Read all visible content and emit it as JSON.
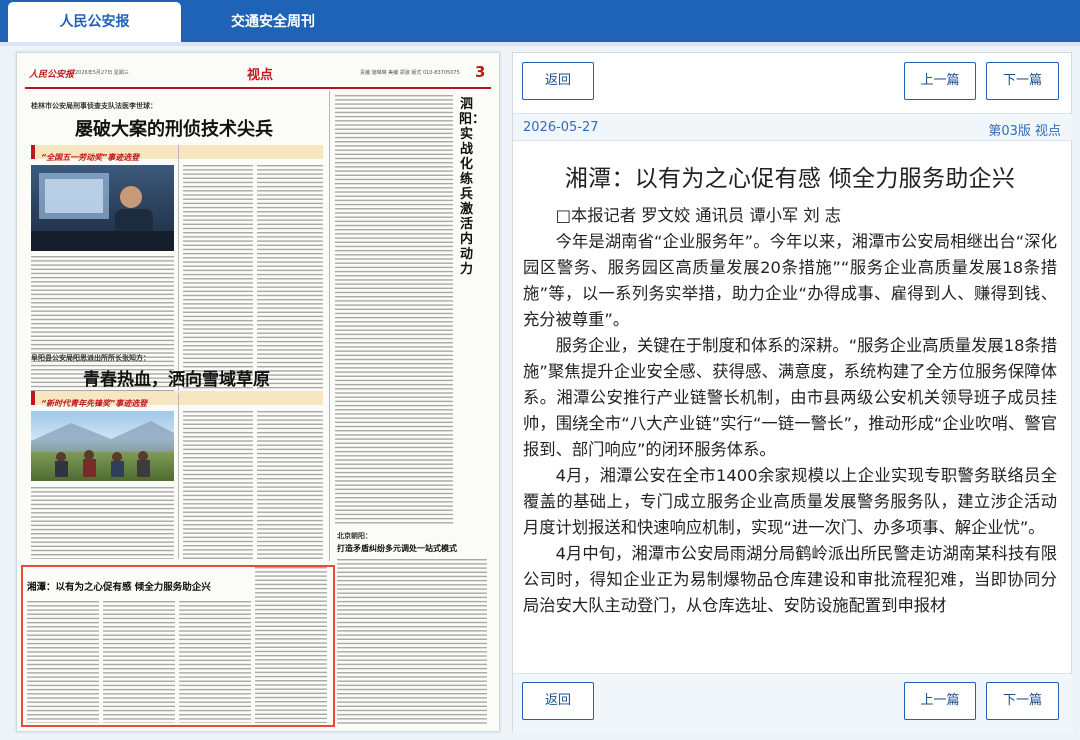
{
  "tabs": [
    {
      "label": "人民公安报",
      "active": true
    },
    {
      "label": "交通安全周刊",
      "active": false
    }
  ],
  "paper": {
    "masthead": "人民公安报",
    "date_line": "2026年5月27日 星期三",
    "section": "视点",
    "edit_line": "责编 施琳琳  美编 郑淑 版式 010-83705075",
    "page_number": "3",
    "story1": {
      "kicker": "桂林市公安局刑事侦查支队法医李世球：",
      "headline": "屡破大案的刑侦技术尖兵",
      "banner": "“全国五一劳动奖”事迹选登"
    },
    "story2": {
      "kicker": "阜阳县公安局阳思派出所所长张知方：",
      "headline": "青春热血，洒向雪域草原",
      "banner": "“新时代青年先锋奖”事迹选登"
    },
    "story3": {
      "vertical_headline": "泗阳：实战化练兵 激活内动力"
    },
    "story4": {
      "kicker": "北京朝阳：",
      "headline": "打造矛盾纠纷多元调处一站式模式"
    },
    "story5": {
      "headline": "湘潭：以有为之心促有感  倾全力服务助企兴"
    }
  },
  "nav": {
    "back": "返回",
    "prev": "上一篇",
    "next": "下一篇"
  },
  "article": {
    "date": "2026-05-27",
    "page_info": "第03版 视点",
    "title": "湘潭：以有为之心促有感 倾全力服务助企兴",
    "byline": "□本报记者 罗文姣 通讯员 谭小军 刘 志",
    "paragraphs": [
      "今年是湖南省“企业服务年”。今年以来，湘潭市公安局相继出台“深化园区警务、服务园区高质量发展20条措施”“服务企业高质量发展18条措施”等，以一系列务实举措，助力企业“办得成事、雇得到人、赚得到钱、充分被尊重”。",
      "服务企业，关键在于制度和体系的深耕。“服务企业高质量发展18条措施”聚焦提升企业安全感、获得感、满意度，系统构建了全方位服务保障体系。湘潭公安推行产业链警长机制，由市县两级公安机关领导班子成员挂帅，围绕全市“八大产业链”实行“一链一警长”，推动形成“企业吹哨、警官报到、部门响应”的闭环服务体系。",
      "4月，湘潭公安在全市1400余家规模以上企业实现专职警务联络员全覆盖的基础上，专门成立服务企业高质量发展警务服务队，建立涉企活动月度计划报送和快速响应机制，实现“进一次门、办多项事、解企业忧”。",
      "4月中旬，湘潭市公安局雨湖分局鹤岭派出所民警走访湖南某科技有限公司时，得知企业正为易制爆物品仓库建设和审批流程犯难，当即协同分局治安大队主动登门，从仓库选址、安防设施配置到申报材"
    ]
  }
}
